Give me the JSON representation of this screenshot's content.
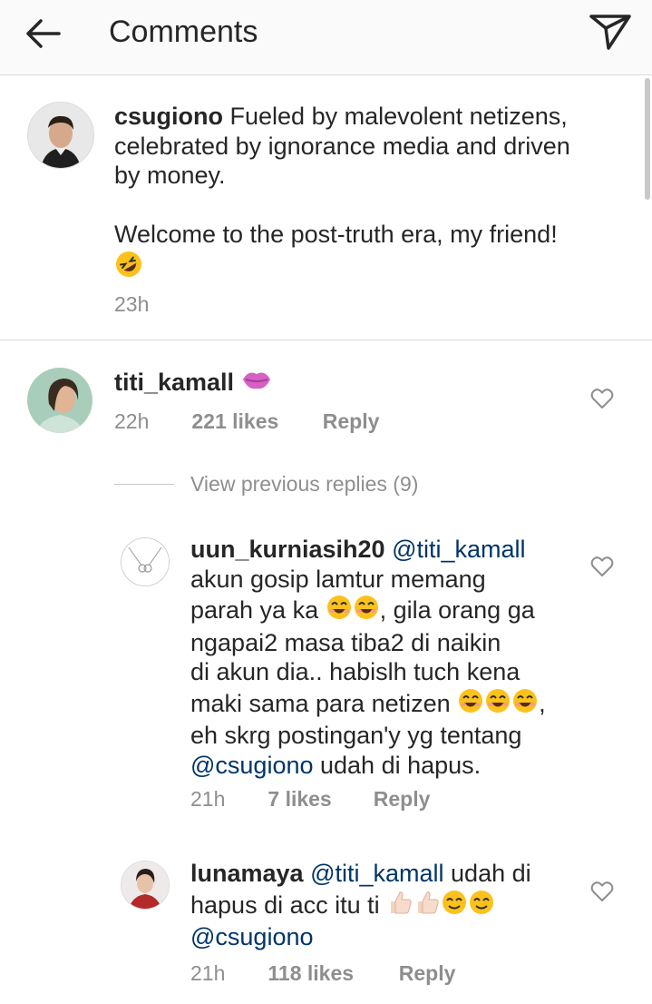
{
  "header": {
    "title": "Comments"
  },
  "caption": {
    "username": "csugiono",
    "text_line1": "Fueled by malevolent netizens,",
    "text_line2": "celebrated by ignorance media and driven",
    "text_line3": "by money.",
    "text_line4": "Welcome to the post-truth era, my friend!",
    "emoji": "rolling-laughing-emoji",
    "time": "23h"
  },
  "comment": {
    "username": "titi_kamall",
    "emoji": "kiss-mark-emoji",
    "time": "22h",
    "likes": "221 likes",
    "reply": "Reply"
  },
  "view_previous": "View previous replies (9)",
  "replies": [
    {
      "username": "uun_kurniasih20",
      "mention": "@titi_kamall",
      "line1": "akun gosip lamtur memang",
      "line2a": "parah ya ka",
      "line2b": ", gila orang ga",
      "line3": "ngapai2 masa tiba2 di naikin",
      "line4": "di akun dia.. habislh tuch kena",
      "line5": "maki sama para netizen",
      "line5b": ",",
      "line6": "eh skrg postingan'y yg tentang",
      "mention2": "@csugiono",
      "line7": " udah di hapus.",
      "time": "21h",
      "likes": "7 likes",
      "reply": "Reply"
    },
    {
      "username": "lunamaya",
      "mention": "@titi_kamall",
      "text1": " udah di",
      "text2": "hapus di acc itu ti ",
      "mention2": "@csugiono",
      "time": "21h",
      "likes": "118 likes",
      "reply": "Reply"
    }
  ],
  "colors": {
    "text": "#262626",
    "secondary": "#8e8e8e",
    "mention": "#003569",
    "divider": "#dbdbdb",
    "header_bg": "#fafafa"
  }
}
